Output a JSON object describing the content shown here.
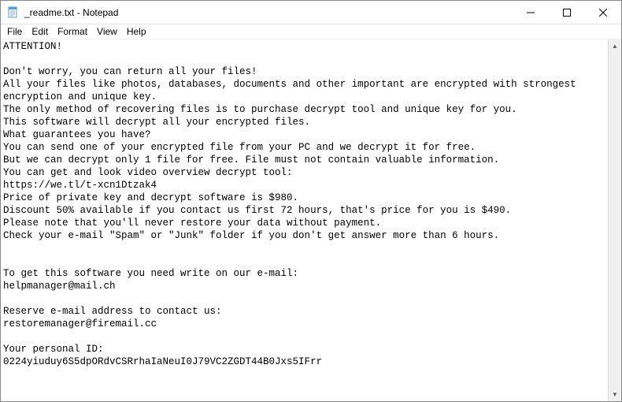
{
  "window": {
    "title": "_readme.txt - Notepad"
  },
  "menu": {
    "file": "File",
    "edit": "Edit",
    "format": "Format",
    "view": "View",
    "help": "Help"
  },
  "document": {
    "text": "ATTENTION!\n\nDon't worry, you can return all your files!\nAll your files like photos, databases, documents and other important are encrypted with strongest encryption and unique key.\nThe only method of recovering files is to purchase decrypt tool and unique key for you.\nThis software will decrypt all your encrypted files.\nWhat guarantees you have?\nYou can send one of your encrypted file from your PC and we decrypt it for free.\nBut we can decrypt only 1 file for free. File must not contain valuable information.\nYou can get and look video overview decrypt tool:\nhttps://we.tl/t-xcn1Dtzak4\nPrice of private key and decrypt software is $980.\nDiscount 50% available if you contact us first 72 hours, that's price for you is $490.\nPlease note that you'll never restore your data without payment.\nCheck your e-mail \"Spam\" or \"Junk\" folder if you don't get answer more than 6 hours.\n\n\nTo get this software you need write on our e-mail:\nhelpmanager@mail.ch\n\nReserve e-mail address to contact us:\nrestoremanager@firemail.cc\n\nYour personal ID:\n0224yiuduy6S5dpORdvCSRrhaIaNeuI0J79VC2ZGDT44B0Jxs5IFrr"
  }
}
